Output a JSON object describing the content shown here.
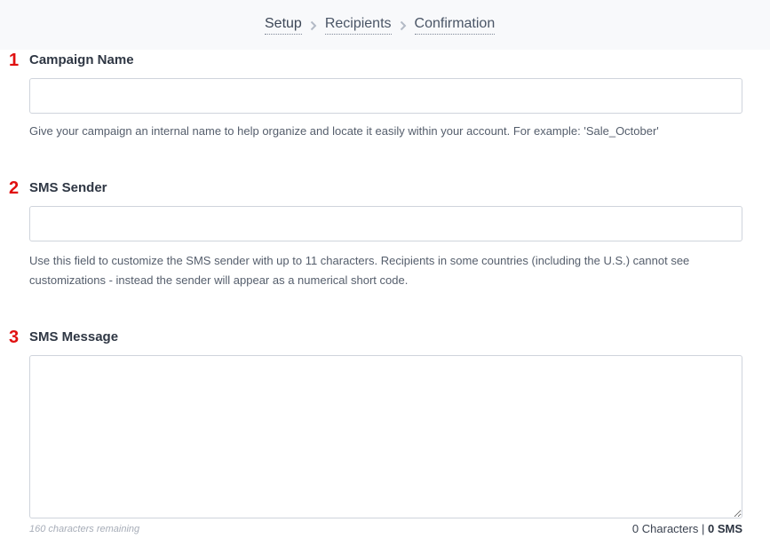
{
  "steps": [
    {
      "label": "Setup",
      "active": true
    },
    {
      "label": "Recipients",
      "active": false
    },
    {
      "label": "Confirmation",
      "active": false
    }
  ],
  "fields": {
    "campaign_name": {
      "number": "1",
      "label": "Campaign Name",
      "value": "",
      "help": "Give your campaign an internal name to help organize and locate it easily within your account. For example: 'Sale_October'"
    },
    "sms_sender": {
      "number": "2",
      "label": "SMS Sender",
      "value": "",
      "help": "Use this field to customize the SMS sender with up to 11 characters. Recipients in some countries (including the U.S.) cannot see customizations - instead the sender will appear as a numerical short code."
    },
    "sms_message": {
      "number": "3",
      "label": "SMS Message",
      "value": "",
      "remaining": "160 characters remaining",
      "characters": "0 Characters",
      "separator": "|",
      "sms_count": "0 SMS"
    }
  },
  "colors": {
    "step_number": "#e01010",
    "topbar_bg": "#f8f9fb",
    "border": "#cfd4dc"
  }
}
